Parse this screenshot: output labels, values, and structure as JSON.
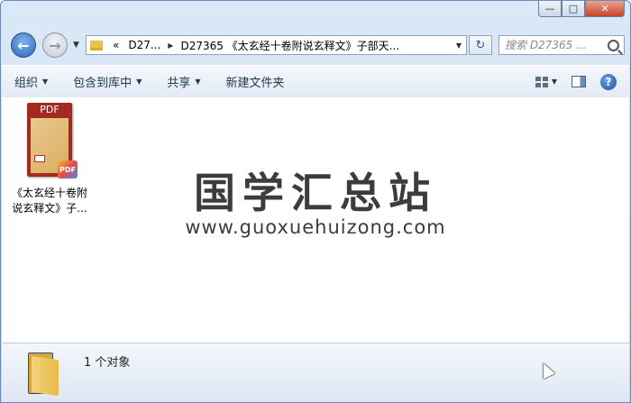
{
  "caption_buttons": {
    "minimize": "—",
    "maximize": "□",
    "close": "✕"
  },
  "nav": {
    "back_glyph": "←",
    "forward_glyph": "→",
    "breadcrumb": [
      "«",
      "D27...",
      "D27365 《太玄经十卷附说玄释文》子部天..."
    ],
    "refresh_glyph": "↻",
    "search_placeholder": "搜索 D27365 ..."
  },
  "toolbar": {
    "organize": "组织",
    "include_in_library": "包含到库中",
    "share": "共享",
    "new_folder": "新建文件夹",
    "help": "?"
  },
  "file": {
    "thumb_label": "PDF",
    "badge": "PDF",
    "name_line1": "《太玄经十卷附",
    "name_line2": "说玄释文》子..."
  },
  "watermark": {
    "title": "国学汇总站",
    "url": "www.guoxuehuizong.com"
  },
  "status": {
    "item_count": "1 个对象"
  }
}
